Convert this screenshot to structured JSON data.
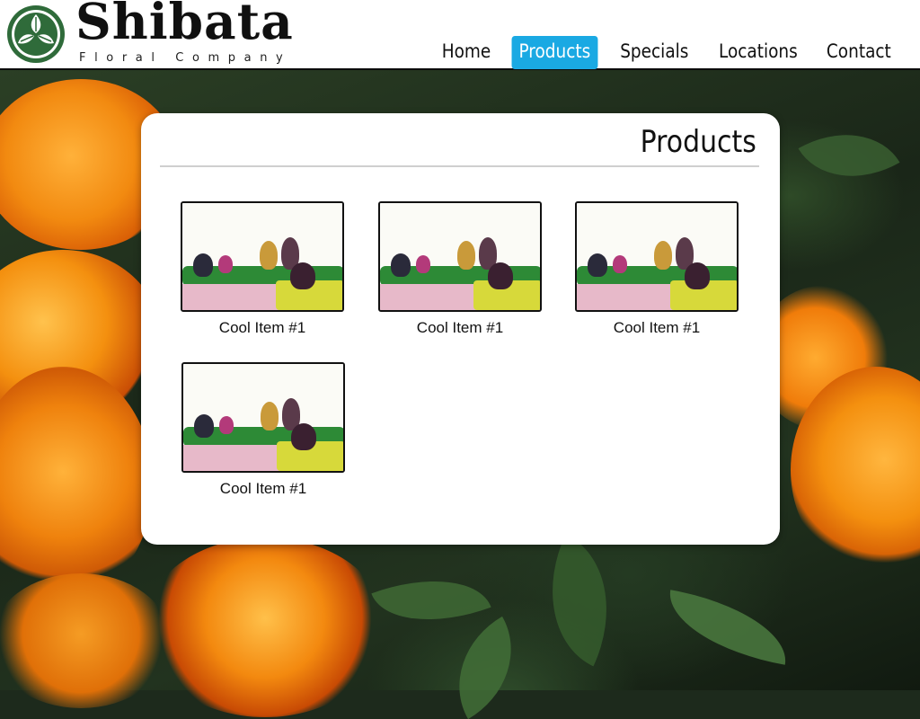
{
  "brand": {
    "name": "Shibata",
    "tagline": "Floral Company",
    "logo_icon": "family-crest-logo-icon"
  },
  "nav": {
    "items": [
      {
        "label": "Home",
        "active": false
      },
      {
        "label": "Products",
        "active": true
      },
      {
        "label": "Specials",
        "active": false
      },
      {
        "label": "Locations",
        "active": false
      },
      {
        "label": "Contact",
        "active": false
      }
    ],
    "active_color": "#1aa9e3"
  },
  "page": {
    "title": "Products"
  },
  "products": [
    {
      "caption": "Cool Item #1"
    },
    {
      "caption": "Cool Item #1"
    },
    {
      "caption": "Cool Item #1"
    },
    {
      "caption": "Cool Item #1"
    }
  ]
}
